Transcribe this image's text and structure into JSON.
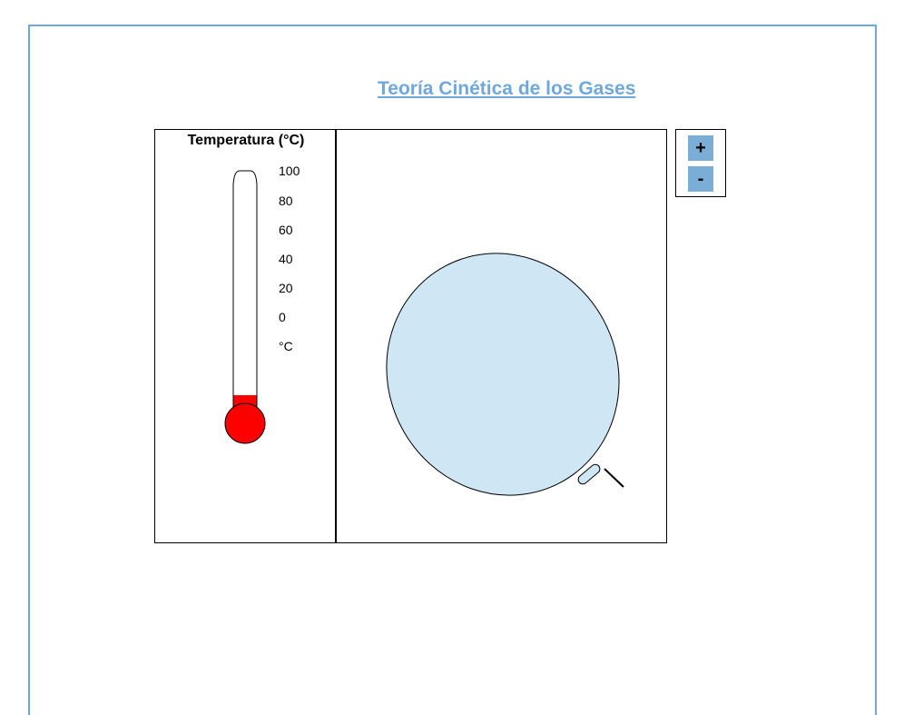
{
  "title": "Teoría Cinética de los Gases",
  "thermometer": {
    "label": "Temperatura (°C)",
    "ticks": [
      "100",
      "80",
      "60",
      "40",
      "20",
      "0",
      "°C"
    ],
    "fill_color": "#ff0000"
  },
  "balloon": {
    "fill_color": "#cfe7f5"
  },
  "controls": {
    "increase_label": "+",
    "decrease_label": "-"
  },
  "colors": {
    "accent": "#6fa8dc",
    "button": "#7aaed6"
  }
}
